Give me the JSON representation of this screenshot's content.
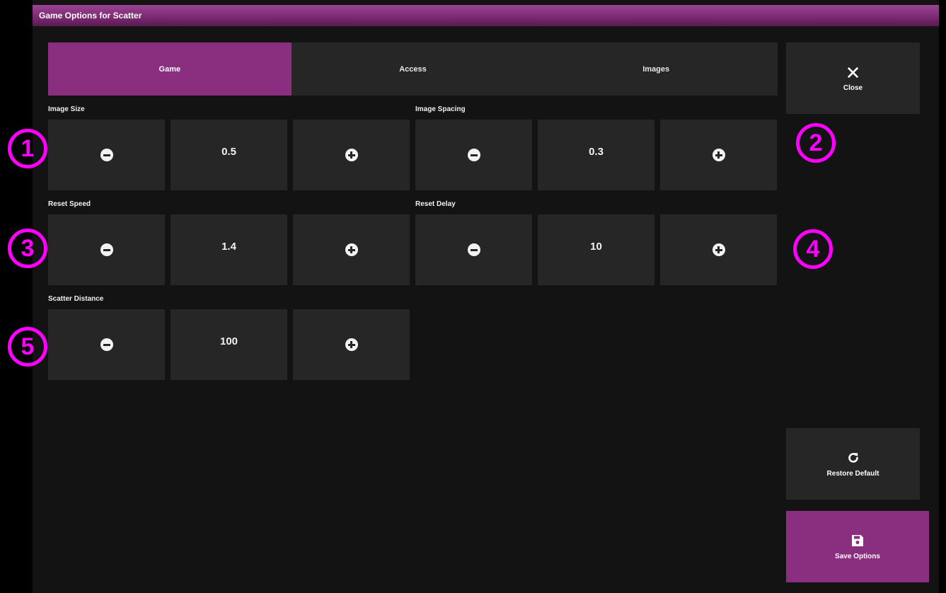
{
  "window": {
    "title": "Game Options for Scatter"
  },
  "tabs": [
    {
      "label": "Game",
      "active": true
    },
    {
      "label": "Access",
      "active": false
    },
    {
      "label": "Images",
      "active": false
    }
  ],
  "close": {
    "label": "Close",
    "icon": "close-icon"
  },
  "settings": [
    {
      "label": "Image Size",
      "value": "0.5"
    },
    {
      "label": "Image Spacing",
      "value": "0.3"
    },
    {
      "label": "Reset Speed",
      "value": "1.4"
    },
    {
      "label": "Reset Delay",
      "value": "10"
    },
    {
      "label": "Scatter Distance",
      "value": "100"
    }
  ],
  "badges": [
    "1",
    "2",
    "3",
    "4",
    "5"
  ],
  "restore": {
    "label": "Restore Default",
    "icon": "refresh-icon"
  },
  "save": {
    "label": "Save Options",
    "icon": "floppy-disk-icon"
  },
  "colors": {
    "accent": "#8a2f7f",
    "panel": "#262626",
    "background": "#131313",
    "annotation": "#ff00ff"
  }
}
